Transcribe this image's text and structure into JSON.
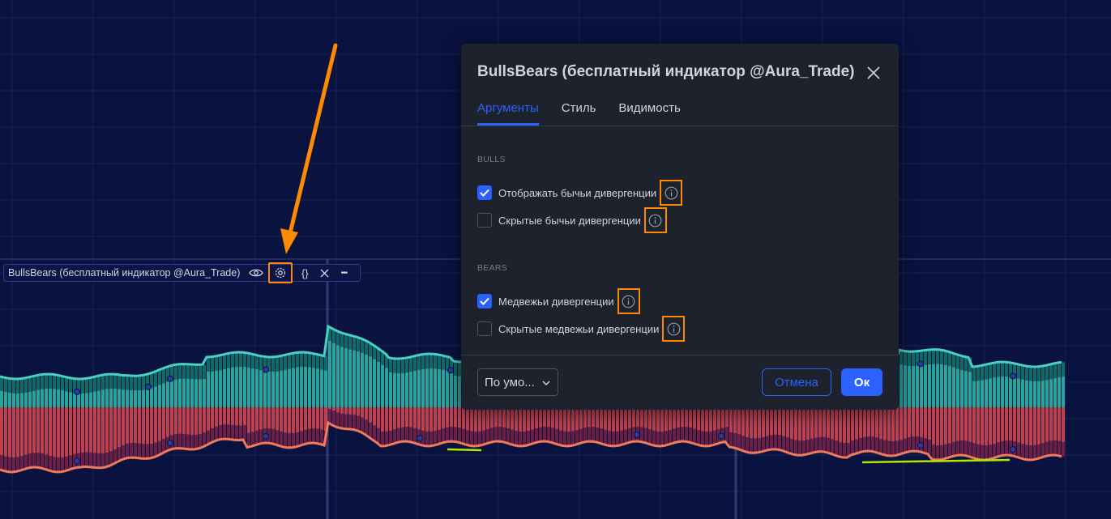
{
  "colors": {
    "background": "#0a1240",
    "grid": "#1a2356",
    "bull": "#26a69a",
    "bull_dark": "#0e6b66",
    "bear": "#c2404e",
    "bear_dark": "#6b1f45",
    "accent": "#2962ff",
    "highlight": "#ff8a00",
    "divergence": "#aeea00"
  },
  "legend": {
    "title": "BullsBears (бесплатный индикатор @Aura_Trade)",
    "icons": [
      "eye-icon",
      "gear-icon",
      "code-braces-icon",
      "close-icon",
      "more-icon"
    ],
    "braces": "{}",
    "more": "•••"
  },
  "dialog": {
    "title": "BullsBears (бесплатный индикатор @Aura_Trade)",
    "tabs": [
      {
        "label": "Аргументы",
        "active": true
      },
      {
        "label": "Стиль",
        "active": false
      },
      {
        "label": "Видимость",
        "active": false
      }
    ],
    "sections": [
      {
        "label": "BULLS",
        "options": [
          {
            "label": "Отображать бычьи дивергенции",
            "checked": true
          },
          {
            "label": "Скрытые бычьи дивергенции",
            "checked": false
          }
        ]
      },
      {
        "label": "BEARS",
        "options": [
          {
            "label": "Медвежьи дивергенции",
            "checked": true
          },
          {
            "label": "Скрытые медвежьи дивергенции",
            "checked": false
          }
        ]
      }
    ],
    "footer": {
      "defaults_label": "По умо...",
      "cancel_label": "Отмена",
      "ok_label": "Ок"
    }
  }
}
